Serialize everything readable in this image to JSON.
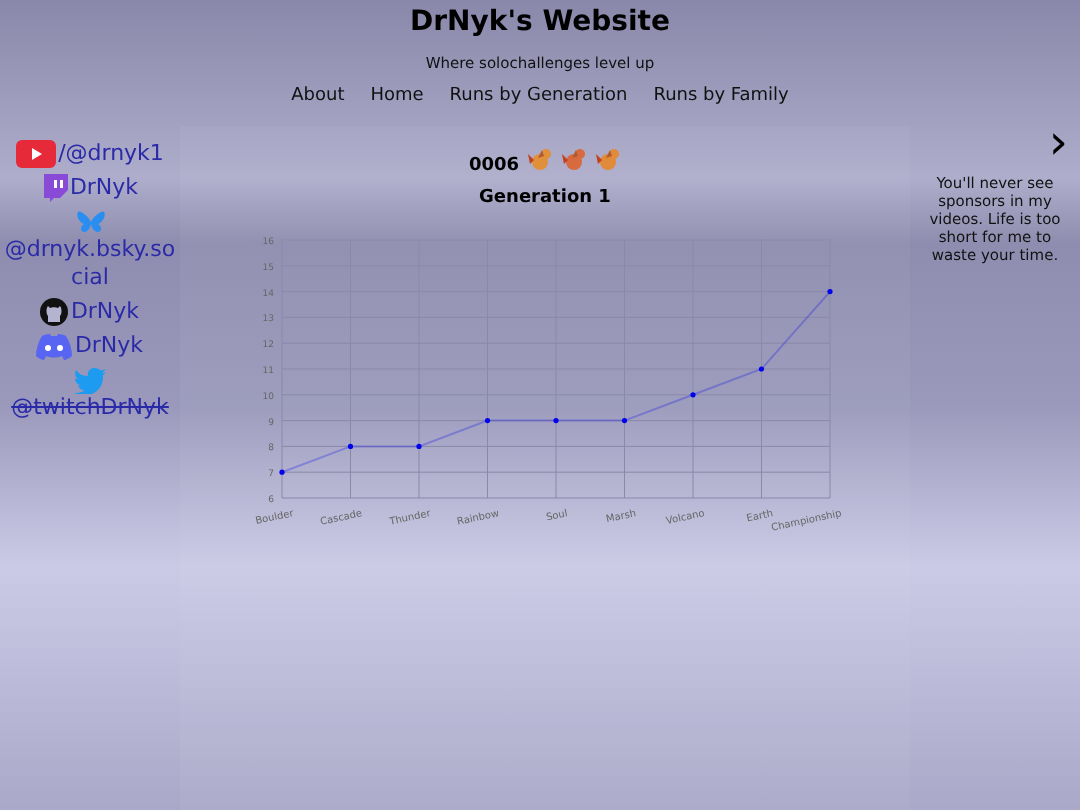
{
  "header": {
    "title": "DrNyk's Website",
    "subtitle": "Where solochallenges level up"
  },
  "nav": [
    "About",
    "Home",
    "Runs by Generation",
    "Runs by Family"
  ],
  "socials": [
    {
      "kind": "youtube",
      "label": "/@drnyk1",
      "struck": false
    },
    {
      "kind": "twitch",
      "label": "DrNyk",
      "struck": false
    },
    {
      "kind": "bluesky",
      "label": "@drnyk.bsky.social",
      "struck": false
    },
    {
      "kind": "github",
      "label": "DrNyk",
      "struck": false
    },
    {
      "kind": "discord",
      "label": "DrNyk",
      "struck": false
    },
    {
      "kind": "twitter",
      "label": "@twitchDrNyk",
      "struck": true
    }
  ],
  "entry": {
    "number": "0006",
    "sprites": [
      {
        "color": "#e0903a"
      },
      {
        "color": "#d86a40"
      },
      {
        "color": "#e08a3a"
      }
    ]
  },
  "chart": {
    "chart_data": {
      "type": "line",
      "title": "Generation 1",
      "categories": [
        "Boulder",
        "Cascade",
        "Thunder",
        "Rainbow",
        "Soul",
        "Marsh",
        "Volcano",
        "Earth",
        "Championship"
      ],
      "grid": true,
      "series": [
        {
          "color": "#0000ee",
          "values": [
            7,
            8,
            8,
            9,
            9,
            9,
            10,
            11,
            14
          ]
        }
      ],
      "ylim": [
        6,
        16
      ],
      "yticks": [
        6,
        7,
        8,
        9,
        10,
        11,
        12,
        13,
        14,
        15,
        16
      ]
    }
  },
  "aside": {
    "next": "›",
    "note": "You'll never see sponsors in my videos. Life is too short for me to waste your time."
  }
}
